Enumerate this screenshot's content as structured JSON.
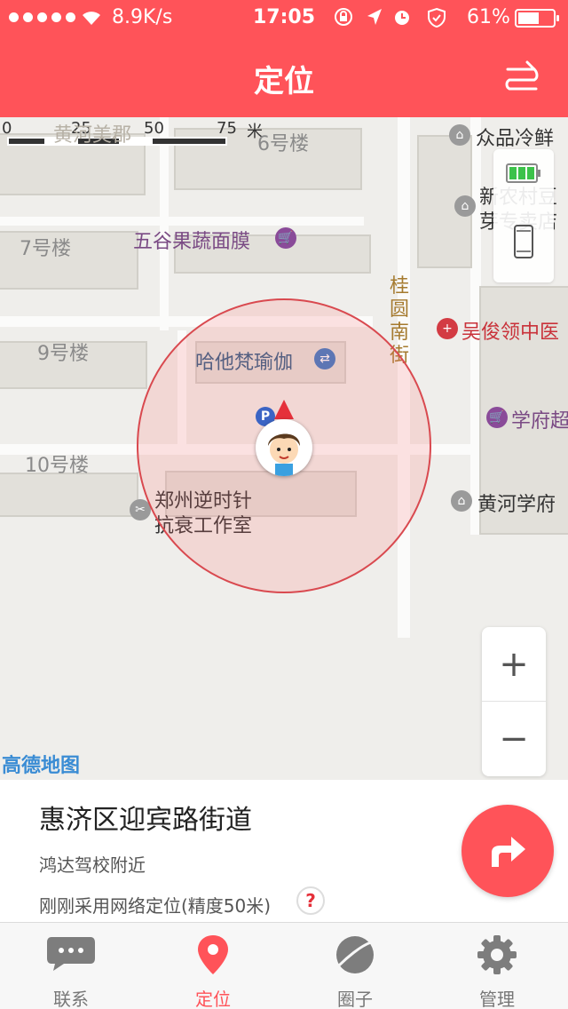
{
  "status_bar": {
    "network_speed": "8.9K/s",
    "time": "17:05",
    "battery_percent": "61%",
    "battery_level": 0.61,
    "icons": [
      "signal-dots-icon",
      "wifi-icon",
      "rotation-lock-icon",
      "location-arrow-icon",
      "alarm-icon",
      "vpn-shield-icon",
      "battery-icon"
    ]
  },
  "header": {
    "title": "定位",
    "switch_icon": "switch-arrows-icon"
  },
  "map": {
    "scale": {
      "ticks": [
        "0",
        "25",
        "50",
        "75"
      ],
      "unit": "米"
    },
    "buildings": [
      "6号楼",
      "7号楼",
      "9号楼",
      "10号楼"
    ],
    "faded_label": "黄河美郡",
    "street_name": "桂圆南街",
    "pois": {
      "zhongpin": "众品冷鲜",
      "xinnongcun_line1": "新农村豆",
      "xinnongcun_line2": "芽专卖店",
      "wugu": "五谷果蔬面膜",
      "yoga": "哈他梵瑜伽",
      "wujunling": "吴俊领中医",
      "xuefu": "学府超",
      "huanghe_xuefu": "黄河学府",
      "studio_line1": "郑州逆时针",
      "studio_line2": "抗衰工作室"
    },
    "parking_label": "P",
    "device_battery_icon": "battery-green-icon",
    "device_phone_icon": "phone-icon",
    "zoom_in": "+",
    "zoom_out": "−",
    "attribution": "高德地图",
    "colors": {
      "accent": "#ff5359",
      "range_border": "#d9494f",
      "map_bg": "#efeeeb"
    }
  },
  "location_card": {
    "address": "惠济区迎宾路街道",
    "nearby": "鸿达驾校附近",
    "accuracy": "刚刚采用网络定位(精度50米)",
    "help_label": "?",
    "navigate_icon": "share-arrow-icon"
  },
  "tabs": [
    {
      "label": "联系",
      "icon": "chat-bubble-icon",
      "active": false
    },
    {
      "label": "定位",
      "icon": "location-pin-icon",
      "active": true
    },
    {
      "label": "圈子",
      "icon": "planet-icon",
      "active": false
    },
    {
      "label": "管理",
      "icon": "gear-icon",
      "active": false
    }
  ]
}
